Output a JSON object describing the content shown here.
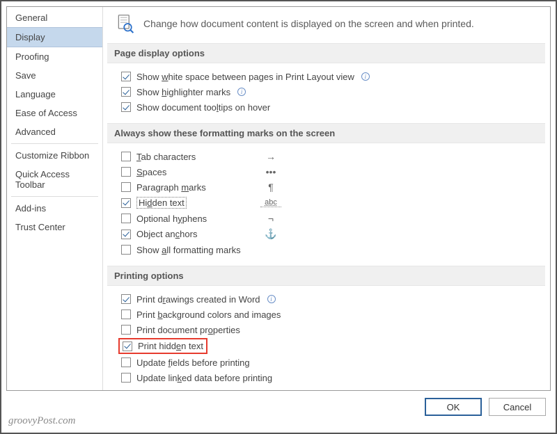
{
  "sidebar": {
    "items": [
      {
        "label": "General"
      },
      {
        "label": "Display"
      },
      {
        "label": "Proofing"
      },
      {
        "label": "Save"
      },
      {
        "label": "Language"
      },
      {
        "label": "Ease of Access"
      },
      {
        "label": "Advanced"
      },
      {
        "label": "Customize Ribbon"
      },
      {
        "label": "Quick Access Toolbar"
      },
      {
        "label": "Add-ins"
      },
      {
        "label": "Trust Center"
      }
    ],
    "selected_index": 1
  },
  "header": {
    "text": "Change how document content is displayed on the screen and when printed."
  },
  "sections": {
    "page_display": {
      "title": "Page display options",
      "options": [
        {
          "html": "Show <u>w</u>hite space between pages in Print Layout view",
          "checked": true,
          "info": true
        },
        {
          "html": "Show <u>h</u>ighlighter marks",
          "checked": true,
          "info": true
        },
        {
          "html": "Show document too<u>l</u>tips on hover",
          "checked": true,
          "info": false
        }
      ]
    },
    "formatting_marks": {
      "title": "Always show these formatting marks on the screen",
      "options": [
        {
          "html": "<u>T</u>ab characters",
          "checked": false,
          "mark": "→",
          "mark_class": ""
        },
        {
          "html": "<u>S</u>paces",
          "checked": false,
          "mark": "•••",
          "mark_class": ""
        },
        {
          "html": "Paragraph <u>m</u>arks",
          "checked": false,
          "mark": "¶",
          "mark_class": ""
        },
        {
          "html": "Hi<u>d</u>den text",
          "checked": true,
          "mark": "abc",
          "mark_class": "abc-mark",
          "focused": true
        },
        {
          "html": "Optional h<u>y</u>phens",
          "checked": false,
          "mark": "¬",
          "mark_class": ""
        },
        {
          "html": "Object an<u>c</u>hors",
          "checked": true,
          "mark": "⚓",
          "mark_class": "anchor-icon"
        },
        {
          "html": "Show <u>a</u>ll formatting marks",
          "checked": false,
          "mark": "",
          "mark_class": ""
        }
      ]
    },
    "printing": {
      "title": "Printing options",
      "options": [
        {
          "html": "Print d<u>r</u>awings created in Word",
          "checked": true,
          "info": true
        },
        {
          "html": "Print <u>b</u>ackground colors and images",
          "checked": false
        },
        {
          "html": "Print document pr<u>o</u>perties",
          "checked": false
        },
        {
          "html": "Print hidd<u>e</u>n text",
          "checked": true,
          "highlighted": true
        },
        {
          "html": "Update <u>f</u>ields before printing",
          "checked": false
        },
        {
          "html": "Update lin<u>k</u>ed data before printing",
          "checked": false
        }
      ]
    }
  },
  "buttons": {
    "ok": "OK",
    "cancel": "Cancel"
  },
  "watermark": "groovyPost.com"
}
